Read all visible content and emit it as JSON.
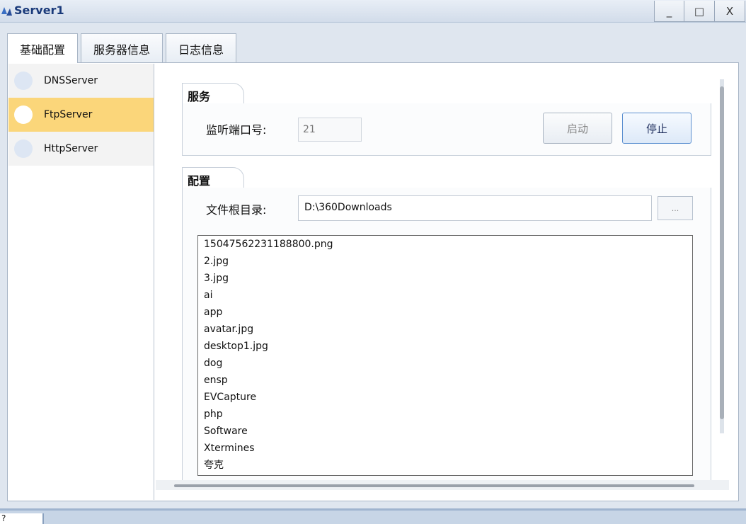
{
  "window": {
    "title": "Server1",
    "minimize": "_",
    "maximize": "□",
    "close": "X"
  },
  "tabs": [
    {
      "label": "基础配置"
    },
    {
      "label": "服务器信息"
    },
    {
      "label": "日志信息"
    }
  ],
  "servers": [
    {
      "label": "DNSServer"
    },
    {
      "label": "FtpServer"
    },
    {
      "label": "HttpServer"
    }
  ],
  "service": {
    "group_title": "服务",
    "port_label": "监听端口号:",
    "port_value": "21",
    "start_label": "启动",
    "stop_label": "停止"
  },
  "config": {
    "group_title": "配置",
    "root_label": "文件根目录:",
    "root_value": "D:\\360Downloads",
    "browse_label": "..."
  },
  "files": [
    "15047562231188800.png",
    "2.jpg",
    "3.jpg",
    "ai",
    "app",
    "avatar.jpg",
    "desktop1.jpg",
    "dog",
    "ensp",
    "EVCapture",
    "php",
    "Software",
    "Xtermines",
    "夸克"
  ],
  "status": {
    "left_text": "?"
  }
}
